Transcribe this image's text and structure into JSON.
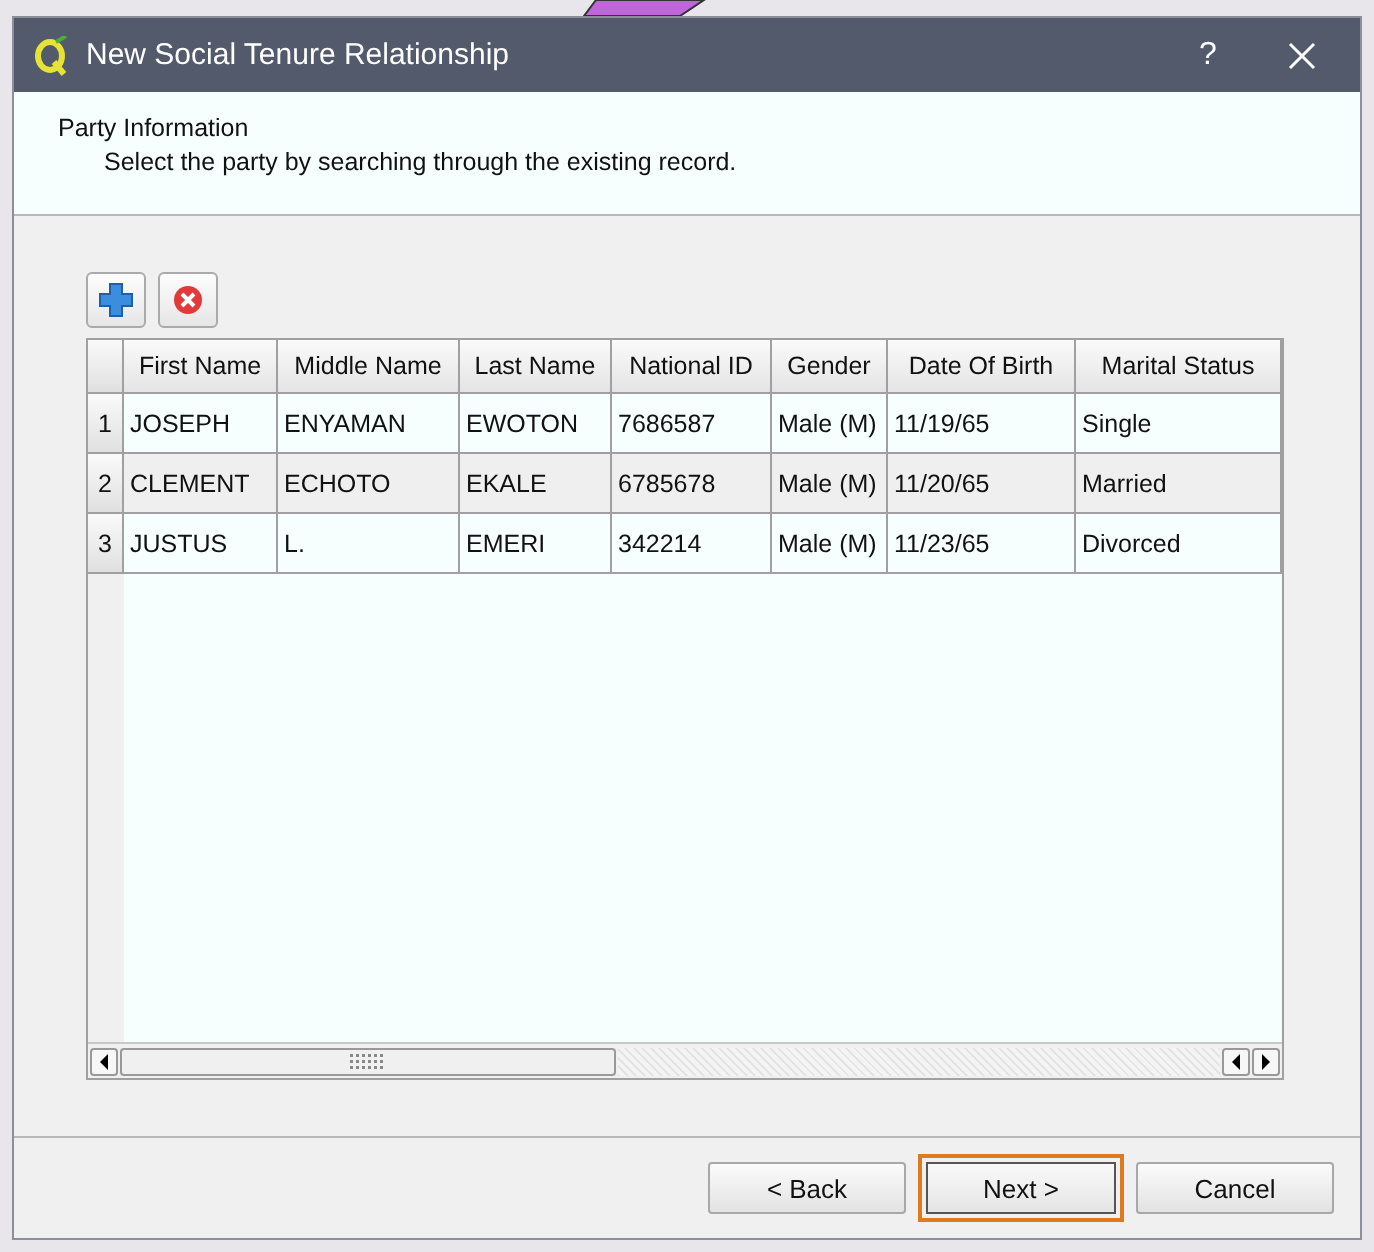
{
  "window": {
    "title": "New Social Tenure Relationship",
    "help": "?"
  },
  "header": {
    "title": "Party Information",
    "subtitle": "Select the party by searching through the existing record."
  },
  "table": {
    "columns": [
      "First Name",
      "Middle Name",
      "Last Name",
      "National ID",
      "Gender",
      "Date Of Birth",
      "Marital Status"
    ],
    "rows": [
      {
        "number": "1",
        "cells": [
          "JOSEPH",
          "ENYAMAN",
          "EWOTON",
          "7686587",
          "Male (M)",
          "11/19/65",
          "Single"
        ]
      },
      {
        "number": "2",
        "cells": [
          "CLEMENT",
          "ECHOTO",
          "EKALE",
          "6785678",
          "Male (M)",
          "11/20/65",
          "Married"
        ]
      },
      {
        "number": "3",
        "cells": [
          "JUSTUS",
          "L.",
          "EMERI",
          "342214",
          "Male (M)",
          "11/23/65",
          "Divorced"
        ]
      }
    ]
  },
  "buttons": [
    {
      "label": "< Back",
      "focused": false
    },
    {
      "label": "Next >",
      "focused": true
    },
    {
      "label": "Cancel",
      "focused": false
    }
  ]
}
